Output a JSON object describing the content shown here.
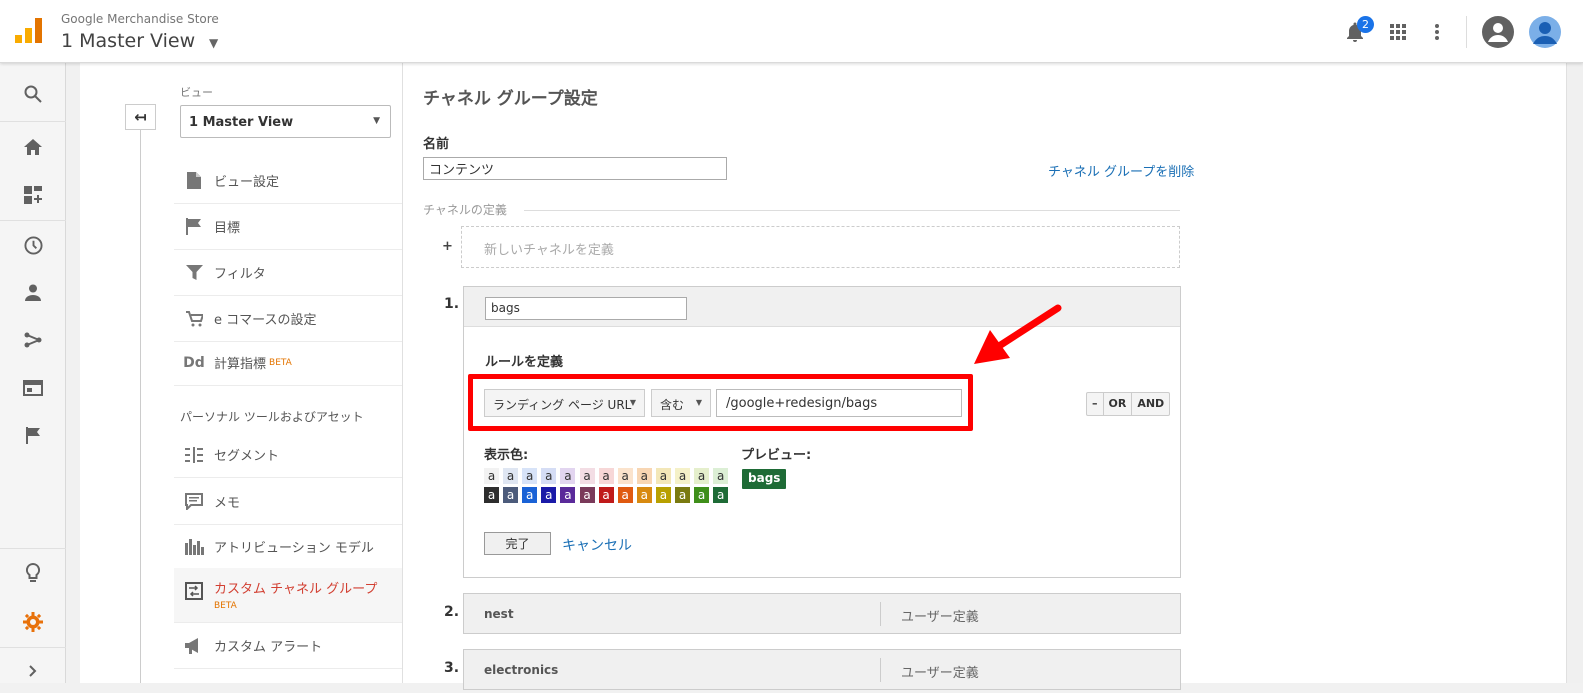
{
  "topbar": {
    "store_name": "Google Merchandise Store",
    "view_name": "1 Master View",
    "notifications_count": "2"
  },
  "admin": {
    "view_label": "ビュー",
    "view_select": "1 Master View",
    "menu": [
      {
        "label": "ビュー設定",
        "icon": "document-icon"
      },
      {
        "label": "目標",
        "icon": "flag-icon"
      },
      {
        "label": "フィルタ",
        "icon": "filter-icon"
      },
      {
        "label": "e コマースの設定",
        "icon": "cart-icon"
      },
      {
        "label": "計算指標",
        "badge": "BETA",
        "icon": "dd-icon"
      }
    ],
    "section_title": "パーソナル ツールおよびアセット",
    "menu2": [
      {
        "label": "セグメント",
        "icon": "segment-icon"
      },
      {
        "label": "メモ",
        "icon": "comment-icon"
      },
      {
        "label": "アトリビューション モデル",
        "icon": "bar-chart-icon"
      },
      {
        "label": "カスタム チャネル グループ",
        "badge": "BETA",
        "icon": "channel-group-icon"
      },
      {
        "label": "カスタム アラート",
        "icon": "megaphone-icon"
      }
    ]
  },
  "main": {
    "title": "チャネル グループ設定",
    "name_label": "名前",
    "name_value": "コンテンツ",
    "delete_link": "チャネル グループを削除",
    "channel_def_label": "チャネルの定義",
    "plus": "+",
    "new_channel": "新しいチャネルを定義",
    "channel1": {
      "number": "1.",
      "name": "bags",
      "rule_label": "ルールを定義",
      "dimension": "ランディング ページ URL",
      "operator": "含む",
      "value": "/google+redesign/bags",
      "btn_minus": "–",
      "btn_or": "OR",
      "btn_and": "AND",
      "color_label": "表示色:",
      "preview_label": "プレビュー:",
      "preview_text": "bags",
      "swatch_char": "a",
      "done": "完了",
      "cancel": "キャンセル"
    },
    "channels": [
      {
        "number": "2.",
        "name": "nest",
        "type": "ユーザー定義"
      },
      {
        "number": "3.",
        "name": "electronics",
        "type": "ユーザー定義"
      }
    ]
  },
  "colors": {
    "swatch_light": [
      "#f2f2f2",
      "#dfe6f2",
      "#d7e3f8",
      "#d5ddf5",
      "#e2d5f0",
      "#f3dde4",
      "#f7d7d7",
      "#fbe3cc",
      "#f8d6b3",
      "#f3e7b8",
      "#f5f1c8",
      "#e5efcc",
      "#dcefd5"
    ],
    "swatch_dark": [
      "#2d2d2d",
      "#4c5b7b",
      "#1a62d6",
      "#1a1aa8",
      "#5a2a9a",
      "#7a3a5a",
      "#c01a1a",
      "#e05a10",
      "#d88a10",
      "#b8a000",
      "#7a7a10",
      "#3f8f1a",
      "#1e6b36"
    ],
    "accent_red": "#ff0000",
    "link_blue": "#1a6fb5"
  }
}
